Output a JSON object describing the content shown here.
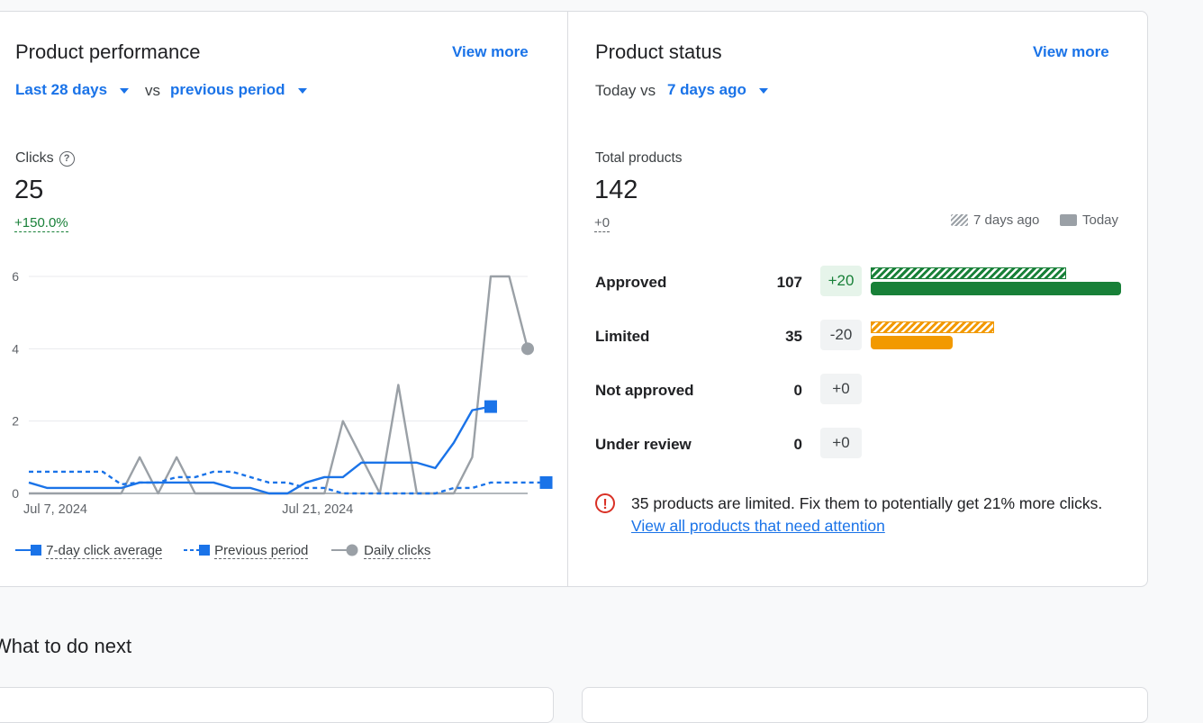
{
  "performance": {
    "title": "Product performance",
    "view_more": "View more",
    "range": "Last 28 days",
    "vs": "vs",
    "compare": "previous period",
    "metric_label": "Clicks",
    "help_icon": "help-circle-icon",
    "value": "25",
    "change": "+150.0%"
  },
  "chart_data": {
    "type": "line",
    "y_ticks": [
      "0",
      "2",
      "4",
      "6"
    ],
    "ylim": [
      0,
      6
    ],
    "x_tick_labels": [
      "Jul 7, 2024",
      "Jul 21, 2024"
    ],
    "x_tick_index": [
      0,
      14
    ],
    "days": 28,
    "series": [
      {
        "name": "7-day click average",
        "color": "#1a73e8",
        "style": "solid",
        "values": [
          0.3,
          0.15,
          0.15,
          0.15,
          0.15,
          0.15,
          0.3,
          0.3,
          0.3,
          0.3,
          0.3,
          0.15,
          0.15,
          0,
          0,
          0.3,
          0.45,
          0.45,
          0.85,
          0.85,
          0.85,
          0.85,
          0.7,
          1.4,
          2.3,
          2.4
        ]
      },
      {
        "name": "Previous period",
        "color": "#1a73e8",
        "style": "dashed",
        "values": [
          0.6,
          0.6,
          0.6,
          0.6,
          0.6,
          0.25,
          0.3,
          0.3,
          0.45,
          0.45,
          0.6,
          0.6,
          0.45,
          0.3,
          0.3,
          0.15,
          0.15,
          0,
          0,
          0,
          0,
          0,
          0,
          0.15,
          0.15,
          0.3,
          0.3,
          0.3,
          0.3
        ]
      },
      {
        "name": "Daily clicks",
        "color": "#9aa0a6",
        "style": "solid",
        "values": [
          0,
          0,
          0,
          0,
          0,
          0,
          1,
          0,
          1,
          0,
          0,
          0,
          0,
          0,
          0,
          0,
          0,
          2,
          1,
          0,
          3,
          0,
          0,
          0,
          1,
          6,
          6,
          4
        ]
      }
    ]
  },
  "legend": {
    "avg": "7-day click average",
    "prev": "Previous period",
    "daily": "Daily clicks"
  },
  "status": {
    "title": "Product status",
    "view_more": "View more",
    "today_vs": "Today vs",
    "compare": "7 days ago",
    "total_label": "Total products",
    "total": "142",
    "total_change": "+0",
    "legend_old": "7 days ago",
    "legend_new": "Today",
    "rows": [
      {
        "name": "Approved",
        "count": "107",
        "change": "+20",
        "color": "#188038",
        "old": 87,
        "new": 107
      },
      {
        "name": "Limited",
        "count": "35",
        "change": "-20",
        "color": "#f29900",
        "old": 55,
        "new": 35
      },
      {
        "name": "Not approved",
        "count": "0",
        "change": "+0",
        "color": "#d93025",
        "old": 0,
        "new": 0
      },
      {
        "name": "Under review",
        "count": "0",
        "change": "+0",
        "color": "#9aa0a6",
        "old": 0,
        "new": 0
      }
    ],
    "alert_icon": "error-icon",
    "alert_text": "35 products are limited. Fix them to potentially get 21% more clicks.",
    "alert_link": "View all products that need attention"
  },
  "next": {
    "title": "What to do next"
  }
}
